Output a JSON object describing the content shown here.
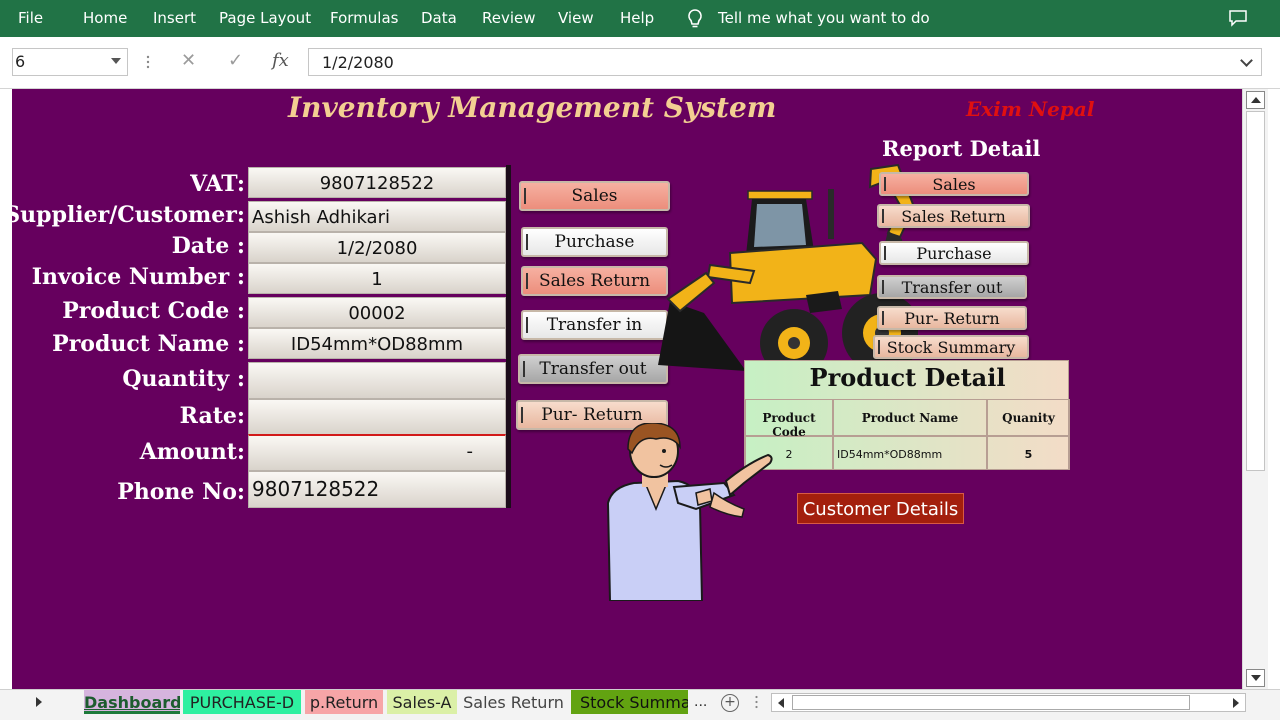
{
  "ribbon": {
    "menu": [
      "File",
      "Home",
      "Insert",
      "Page Layout",
      "Formulas",
      "Data",
      "Review",
      "View",
      "Help"
    ],
    "tell_me": "Tell me what you want to do",
    "icons": [
      "lightbulb-icon",
      "comment-icon"
    ]
  },
  "formula_bar": {
    "name_box": "6",
    "cancel": "✕",
    "enter": "✓",
    "fx": "fx",
    "value": "1/2/2080"
  },
  "sheet": {
    "title": "Inventory Management System",
    "company": "Exim Nepal",
    "report_title": "Report Detail",
    "background_color": "#66005e"
  },
  "form": {
    "vat_label": "VAT:",
    "vat_value": "9807128522",
    "supplier_label": "Supplier/Customer:",
    "supplier_value": "Ashish Adhikari",
    "date_label": "Date :",
    "date_value": "1/2/2080",
    "invoice_label": "Invoice Number :",
    "invoice_value": "1",
    "product_code_label": "Product Code :",
    "product_code_value": "00002",
    "product_name_label": "Product Name :",
    "product_name_value": "ID54mm*OD88mm",
    "quantity_label": "Quantity :",
    "quantity_value": "",
    "rate_label": "Rate:",
    "rate_value": "",
    "amount_label": "Amount:",
    "amount_value": "-",
    "phone_label": "Phone No:",
    "phone_value": "9807128522"
  },
  "entry_buttons": {
    "sales": "Sales",
    "purchase": "Purchase",
    "sales_return": "Sales Return",
    "transfer_in": "Transfer in",
    "transfer_out": "Transfer out",
    "pur_return": "Pur- Return"
  },
  "report_buttons": {
    "sales": "Sales",
    "sales_return": "Sales Return",
    "purchase": "Purchase",
    "transfer_out": "Transfer out",
    "pur_return": "Pur- Return",
    "stock_summary": "Stock Summary"
  },
  "product_detail": {
    "title": "Product Detail",
    "headers": [
      "Product Code",
      "Product Name",
      "Quanity"
    ],
    "row": [
      "2",
      "ID54mm*OD88mm",
      "5"
    ]
  },
  "customer_details_button": "Customer Details",
  "tabs": [
    "Dashboard",
    "PURCHASE-D",
    "p.Return",
    "Sales-A",
    "Sales Return",
    "Stock Summary"
  ],
  "tabs_more": "...",
  "add_sheet": "+",
  "colors": {
    "excel_green": "#217346",
    "title_gold": "#f3cf92",
    "company_red": "#e01010",
    "customer_btn": "#a31f0d"
  }
}
